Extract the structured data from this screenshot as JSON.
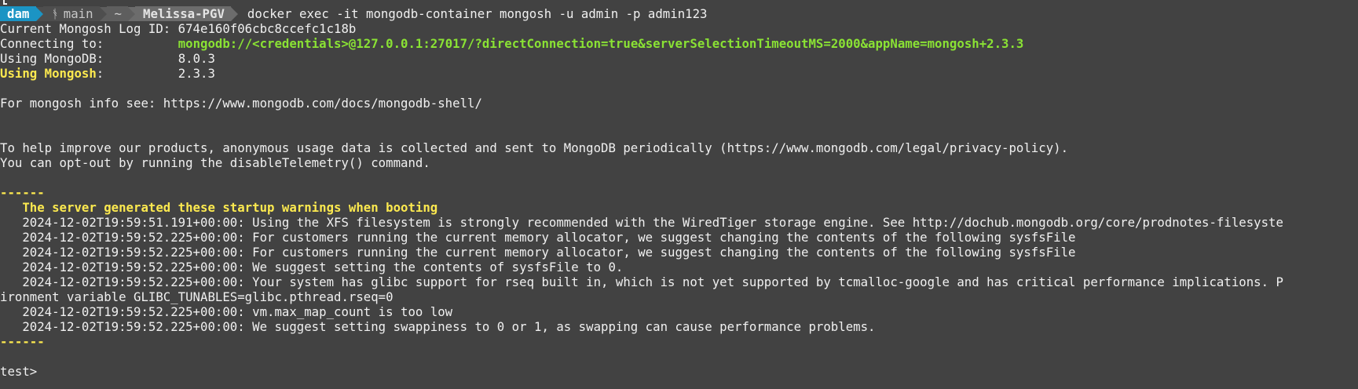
{
  "prompt": {
    "user": "dam",
    "git_branch": "main",
    "dir_home": "~",
    "dir_name": "Melissa-PGV",
    "command": "docker exec -it mongodb-container mongosh -u admin -p admin123"
  },
  "output": {
    "log_id_line": "Current Mongosh Log ID: 674e160f06cbc8ccefc1c18b",
    "connecting_label": "Connecting to:          ",
    "connecting_value": "mongodb://<credentials>@127.0.0.1:27017/?directConnection=true&serverSelectionTimeoutMS=2000&appName=mongosh+2.3.3",
    "mongodb_label": "Using MongoDB:          ",
    "mongodb_version": "8.0.3",
    "mongosh_label": "Using Mongosh",
    "mongosh_label_rest": ":          ",
    "mongosh_version": "2.3.3",
    "info_line": "For mongosh info see: https://www.mongodb.com/docs/mongodb-shell/",
    "telemetry_line_1": "To help improve our products, anonymous usage data is collected and sent to MongoDB periodically (https://www.mongodb.com/legal/privacy-policy).",
    "telemetry_line_2": "You can opt-out by running the disableTelemetry() command.",
    "separator": "------",
    "warnings_header": "   The server generated these startup warnings when booting",
    "warnings": [
      "   2024-12-02T19:59:51.191+00:00: Using the XFS filesystem is strongly recommended with the WiredTiger storage engine. See http://dochub.mongodb.org/core/prodnotes-filesyste",
      "   2024-12-02T19:59:52.225+00:00: For customers running the current memory allocator, we suggest changing the contents of the following sysfsFile",
      "   2024-12-02T19:59:52.225+00:00: For customers running the current memory allocator, we suggest changing the contents of the following sysfsFile",
      "   2024-12-02T19:59:52.225+00:00: We suggest setting the contents of sysfsFile to 0.",
      "   2024-12-02T19:59:52.225+00:00: Your system has glibc support for rseq built in, which is not yet supported by tcmalloc-google and has critical performance implications. P",
      "ironment variable GLIBC_TUNABLES=glibc.pthread.rseq=0",
      "   2024-12-02T19:59:52.225+00:00: vm.max_map_count is too low",
      "   2024-12-02T19:59:52.225+00:00: We suggest setting swappiness to 0 or 1, as swapping can cause performance problems."
    ],
    "shell_prompt": "test>"
  },
  "colors": {
    "background": "#424242",
    "text": "#f0f0f0",
    "green": "#8ae234",
    "yellow": "#fce94f",
    "user_segment": "#1b94c4"
  }
}
